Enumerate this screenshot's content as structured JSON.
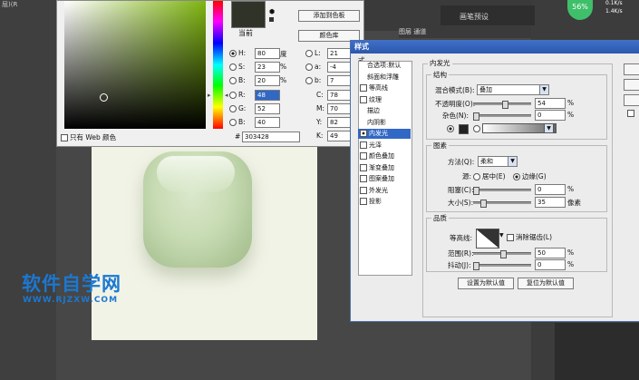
{
  "background_app": {
    "tab_fragment": "屈)(R",
    "preset_label": "画笔预设",
    "performance_percent": "56%",
    "net_up": "0.1K/s",
    "net_down": "1.4K/s",
    "layers_tab": "图层  通道"
  },
  "watermark": {
    "title": "软件自学网",
    "url": "WWW.RJZXW.COM"
  },
  "color_picker": {
    "current_label": "当前",
    "add_swatch_button": "添加到色板",
    "color_library_button": "颜色库",
    "hsb": {
      "h_label": "H:",
      "h_value": "80",
      "h_unit": "度",
      "s_label": "S:",
      "s_value": "23",
      "s_unit": "%",
      "b_label": "B:",
      "b_value": "20",
      "b_unit": "%"
    },
    "lab": {
      "l_label": "L:",
      "l_value": "21",
      "a_label": "a:",
      "a_value": "-4",
      "b_label": "b:",
      "b_value": "7"
    },
    "rgb": {
      "r_label": "R:",
      "r_value": "48",
      "g_label": "G:",
      "g_value": "52",
      "b_label": "B:",
      "b_value": "40"
    },
    "cmyk": {
      "c_label": "C:",
      "c_value": "78",
      "c_unit": "%",
      "m_label": "M:",
      "m_value": "70",
      "m_unit": "%",
      "y_label": "Y:",
      "y_value": "82",
      "y_unit": "%",
      "k_label": "K:",
      "k_value": "49",
      "k_unit": "%"
    },
    "web_only_label": "只有 Web 颜色",
    "hex_label": "#",
    "hex_value": "303428",
    "selected_color": "#303428"
  },
  "layer_style": {
    "title": "样式",
    "list_header": "式",
    "list_items": [
      {
        "label": "合选项:默认",
        "checked": false,
        "has_checkbox": false
      },
      {
        "label": "斜面和浮雕",
        "checked": false,
        "has_checkbox": false
      },
      {
        "label": "等高线",
        "checked": false,
        "has_checkbox": true
      },
      {
        "label": "纹理",
        "checked": false,
        "has_checkbox": true
      },
      {
        "label": "描边",
        "checked": false,
        "has_checkbox": false
      },
      {
        "label": "内阴影",
        "checked": false,
        "has_checkbox": false
      },
      {
        "label": "内发光",
        "checked": true,
        "has_checkbox": true,
        "selected": true
      },
      {
        "label": "光泽",
        "checked": false,
        "has_checkbox": true
      },
      {
        "label": "颜色叠加",
        "checked": false,
        "has_checkbox": true
      },
      {
        "label": "渐变叠加",
        "checked": false,
        "has_checkbox": true
      },
      {
        "label": "图案叠加",
        "checked": false,
        "has_checkbox": true
      },
      {
        "label": "外发光",
        "checked": false,
        "has_checkbox": true
      },
      {
        "label": "投影",
        "checked": false,
        "has_checkbox": true
      }
    ],
    "inner_glow": {
      "section_title": "内发光",
      "structure_title": "结构",
      "blend_mode_label": "混合模式(B):",
      "blend_mode_value": "叠加",
      "opacity_label": "不透明度(O):",
      "opacity_value": "54",
      "opacity_unit": "%",
      "noise_label": "杂色(N):",
      "noise_value": "0",
      "noise_unit": "%",
      "elements_title": "图素",
      "technique_label": "方法(Q):",
      "technique_value": "柔和",
      "source_label": "源:",
      "source_center": "居中(E)",
      "source_edge": "边缘(G)",
      "choke_label": "阻塞(C):",
      "choke_value": "0",
      "choke_unit": "%",
      "size_label": "大小(S):",
      "size_value": "35",
      "size_unit": "像素",
      "quality_title": "品质",
      "contour_label": "等高线:",
      "anti_alias_label": "消除锯齿(L)",
      "range_label": "范围(R):",
      "range_value": "50",
      "range_unit": "%",
      "jitter_label": "抖动(J):",
      "jitter_value": "0",
      "jitter_unit": "%",
      "opacity_level": 0.54,
      "size_level": 0.14,
      "range_level": 0.5
    },
    "make_default_button": "设置为默认值",
    "reset_default_button": "复位为默认值"
  }
}
